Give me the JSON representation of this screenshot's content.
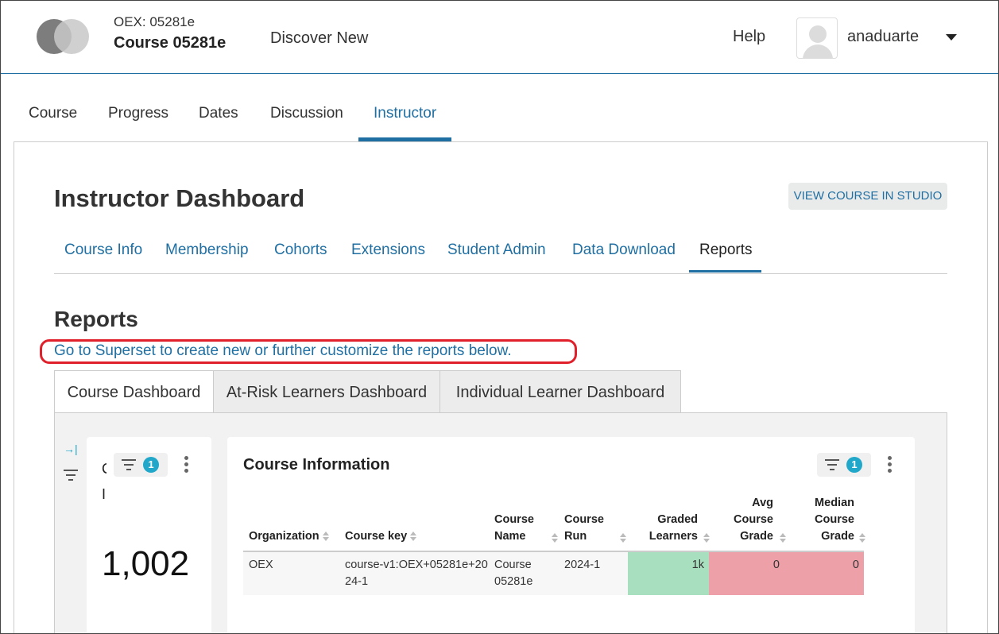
{
  "header": {
    "org": "OEX: 05281e",
    "course_title": "Course 05281e",
    "discover": "Discover New",
    "help": "Help",
    "username": "anaduarte"
  },
  "course_nav": {
    "tabs": [
      {
        "label": "Course"
      },
      {
        "label": "Progress"
      },
      {
        "label": "Dates"
      },
      {
        "label": "Discussion"
      },
      {
        "label": "Instructor",
        "active": true
      }
    ]
  },
  "dashboard": {
    "title": "Instructor Dashboard",
    "studio_button": "VIEW COURSE IN STUDIO",
    "tabs": [
      {
        "label": "Course Info"
      },
      {
        "label": "Membership"
      },
      {
        "label": "Cohorts"
      },
      {
        "label": "Extensions"
      },
      {
        "label": "Student Admin"
      },
      {
        "label": "Data Download"
      },
      {
        "label": "Reports",
        "active": true
      }
    ]
  },
  "reports": {
    "heading": "Reports",
    "superset_link": "Go to Superset to create new or further customize the reports below.",
    "dash_tabs": [
      {
        "label": "Course Dashboard",
        "active": true
      },
      {
        "label": "At-Risk Learners Dashboard"
      },
      {
        "label": "Individual Learner Dashboard"
      }
    ]
  },
  "left_card": {
    "clipped_title": "C I",
    "filter_count": "1",
    "big_number": "1,002"
  },
  "info_card": {
    "title": "Course Information",
    "filter_count": "1",
    "columns": [
      "Organization",
      "Course key",
      "Course Name",
      "Course Run",
      "Graded Learners",
      "Avg Course Grade",
      "Median Course Grade"
    ],
    "row": {
      "organization": "OEX",
      "course_key": "course-v1:OEX+05281e+2024-1",
      "course_name": "Course 05281e",
      "course_run": "2024-1",
      "graded_learners": "1k",
      "avg_grade": "0",
      "median_grade": "0"
    }
  },
  "colors": {
    "link": "#1f6fa3",
    "highlight": "#e0202a",
    "badge": "#20a7c9",
    "green_cell": "#a8e0bf",
    "red_cell": "#eda0a8"
  }
}
